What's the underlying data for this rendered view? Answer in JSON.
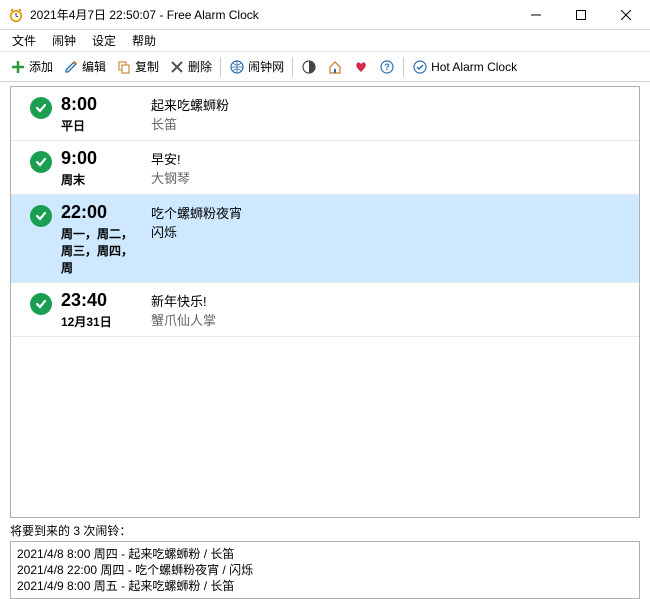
{
  "window": {
    "title": "2021年4月7日 22:50:07 - Free Alarm Clock"
  },
  "menu": {
    "file": "文件",
    "alarm": "闹钟",
    "settings": "设定",
    "help": "帮助"
  },
  "toolbar": {
    "add": "添加",
    "edit": "编辑",
    "copy": "复制",
    "delete": "删除",
    "web": "闹钟网",
    "hotalarm": "Hot Alarm Clock"
  },
  "alarms": [
    {
      "time": "8:00",
      "schedule": "平日",
      "title": "起来吃螺蛳粉",
      "sound": "长笛",
      "selected": false
    },
    {
      "time": "9:00",
      "schedule": "周末",
      "title": "早安!",
      "sound": "大钢琴",
      "selected": false
    },
    {
      "time": "22:00",
      "schedule": "周一，周二，周三，周四，周",
      "title": "吃个螺蛳粉夜宵",
      "sound": "闪烁",
      "selected": true
    },
    {
      "time": "23:40",
      "schedule": "12月31日",
      "title": "新年快乐!",
      "sound": "蟹爪仙人掌",
      "selected": false
    }
  ],
  "upcoming": {
    "label": "将要到来的 3 次闹铃：",
    "lines": [
      "2021/4/8 8:00 周四 - 起来吃螺蛳粉 / 长笛",
      "2021/4/8 22:00 周四 - 吃个螺蛳粉夜宵 / 闪烁",
      "2021/4/9 8:00 周五 - 起来吃螺蛳粉 / 长笛"
    ]
  }
}
